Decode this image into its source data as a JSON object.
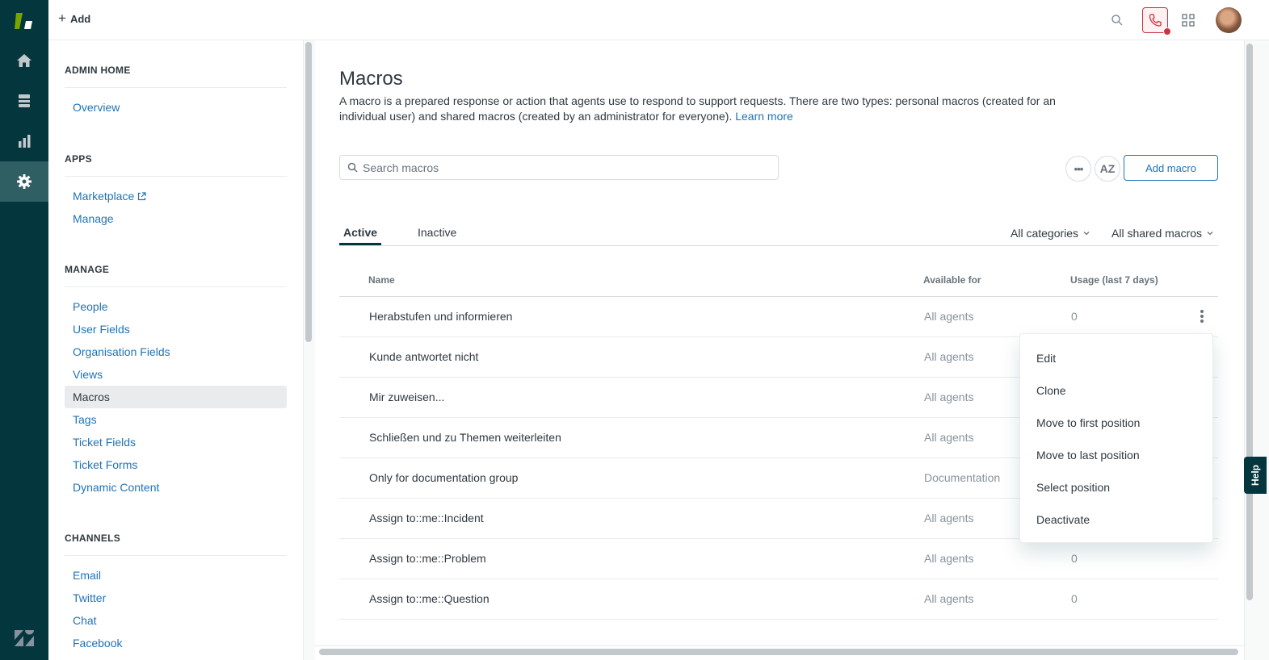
{
  "header": {
    "add_label": "Add"
  },
  "rail": {
    "items": [
      {
        "icon": "home-icon"
      },
      {
        "icon": "views-icon"
      },
      {
        "icon": "reporting-icon"
      },
      {
        "icon": "admin-gear-icon"
      }
    ]
  },
  "sidebar": {
    "sections": [
      {
        "heading": "ADMIN HOME",
        "items": [
          {
            "label": "Overview"
          }
        ]
      },
      {
        "heading": "APPS",
        "items": [
          {
            "label": "Marketplace"
          },
          {
            "label": "Manage"
          }
        ]
      },
      {
        "heading": "MANAGE",
        "items": [
          {
            "label": "People"
          },
          {
            "label": "User Fields"
          },
          {
            "label": "Organisation Fields"
          },
          {
            "label": "Views"
          },
          {
            "label": "Macros"
          },
          {
            "label": "Tags"
          },
          {
            "label": "Ticket Fields"
          },
          {
            "label": "Ticket Forms"
          },
          {
            "label": "Dynamic Content"
          }
        ]
      },
      {
        "heading": "CHANNELS",
        "items": [
          {
            "label": "Email"
          },
          {
            "label": "Twitter"
          },
          {
            "label": "Chat"
          },
          {
            "label": "Facebook"
          }
        ]
      }
    ],
    "active_item": "Macros"
  },
  "main": {
    "title": "Macros",
    "description": "A macro is a prepared response or action that agents use to respond to support requests. There are two types: personal macros (created for an individual user) and shared macros (created by an administrator for everyone).",
    "learn_more": "Learn more",
    "search_placeholder": "Search macros",
    "more_label": "•••",
    "sort_label": "AZ",
    "add_macro_label": "Add macro",
    "tabs": [
      {
        "label": "Active"
      },
      {
        "label": "Inactive"
      }
    ],
    "filters": [
      {
        "label": "All categories"
      },
      {
        "label": "All shared macros"
      }
    ],
    "columns": {
      "name": "Name",
      "available": "Available for",
      "usage": "Usage (last 7 days)"
    },
    "rows": [
      {
        "name": "Herabstufen und informieren",
        "available": "All agents",
        "usage": "0"
      },
      {
        "name": "Kunde antwortet nicht",
        "available": "All agents",
        "usage": ""
      },
      {
        "name": "Mir zuweisen...",
        "available": "All agents",
        "usage": ""
      },
      {
        "name": "Schließen und zu Themen weiterleiten",
        "available": "All agents",
        "usage": ""
      },
      {
        "name": "Only for documentation group",
        "available": "Documentation",
        "usage": ""
      },
      {
        "name": "Assign to::me::Incident",
        "available": "All agents",
        "usage": ""
      },
      {
        "name": "Assign to::me::Problem",
        "available": "All agents",
        "usage": "0"
      },
      {
        "name": "Assign to::me::Question",
        "available": "All agents",
        "usage": "0"
      }
    ],
    "menu_items": [
      {
        "label": "Edit"
      },
      {
        "label": "Clone"
      },
      {
        "label": "Move to first position"
      },
      {
        "label": "Move to last position"
      },
      {
        "label": "Select position"
      },
      {
        "label": "Deactivate"
      }
    ]
  },
  "help_label": "Help",
  "colors": {
    "rail": "#03363d",
    "link": "#1f73b7",
    "alert": "#cc3340"
  }
}
